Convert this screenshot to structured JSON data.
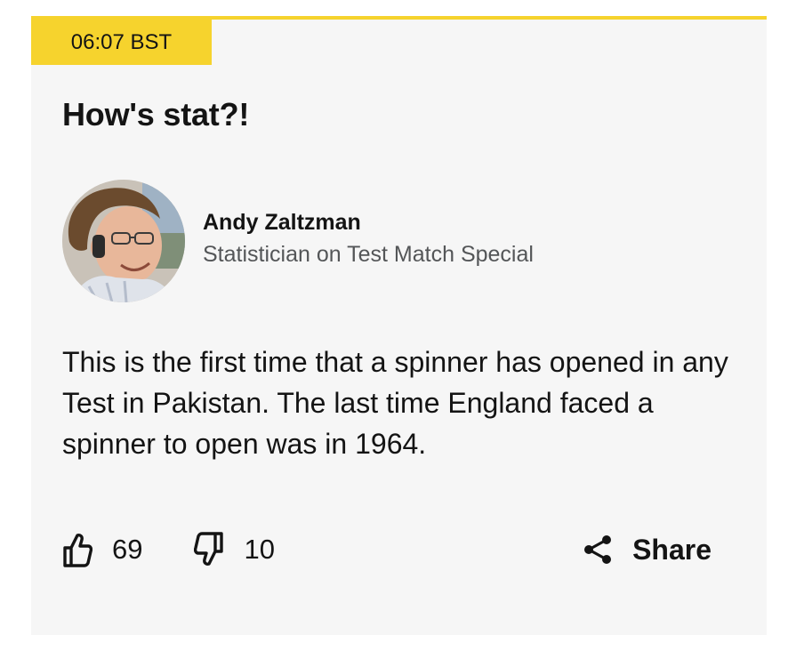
{
  "post": {
    "time": "06:07 BST",
    "title": "How's stat?!",
    "author": {
      "name": "Andy Zaltzman",
      "role": "Statistician on Test Match Special"
    },
    "body": "This is the first time that a spinner has opened in any Test in Pakistan. The last time England faced a spinner to open was in 1964.",
    "reactions": {
      "likes": "69",
      "dislikes": "10"
    },
    "share_label": "Share"
  },
  "colors": {
    "accent": "#f6d32d",
    "card_background": "#f6f6f6",
    "text": "#141414",
    "secondary_text": "#545658"
  },
  "icons": [
    "thumbs-up-icon",
    "thumbs-down-icon",
    "share-icon"
  ]
}
